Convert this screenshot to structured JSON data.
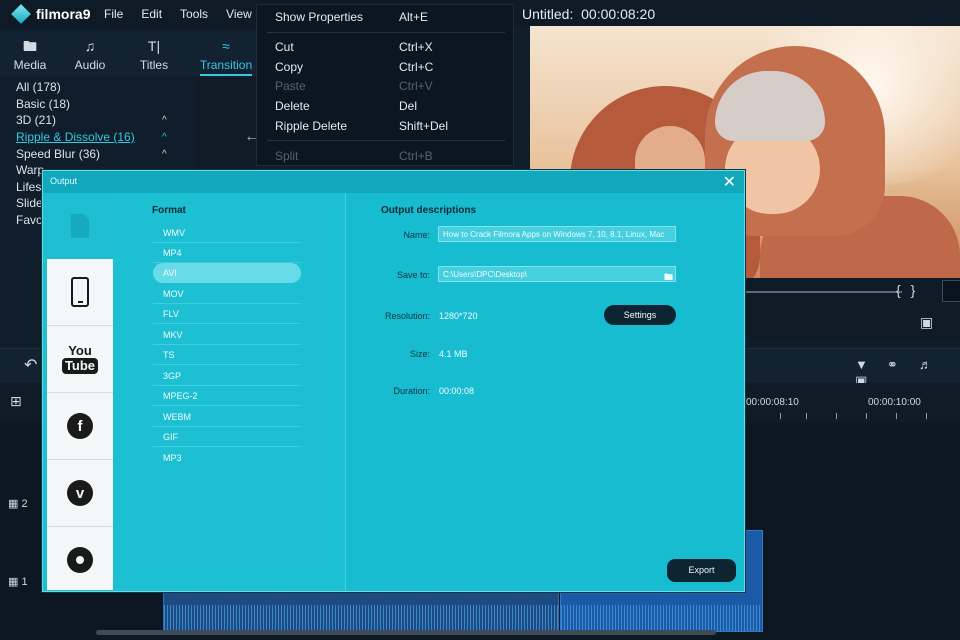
{
  "app": {
    "logo": "filmora",
    "logo_version": "9",
    "window_title": "Untitled:",
    "window_time": "00:00:08:20"
  },
  "menubar": {
    "items": [
      "File",
      "Edit",
      "Tools",
      "View"
    ]
  },
  "edit_menu": {
    "items": [
      {
        "label": "Show Properties",
        "shortcut": "Alt+E",
        "enabled": true
      },
      {
        "label": "Cut",
        "shortcut": "Ctrl+X",
        "enabled": true
      },
      {
        "label": "Copy",
        "shortcut": "Ctrl+C",
        "enabled": true
      },
      {
        "label": "Paste",
        "shortcut": "Ctrl+V",
        "enabled": false
      },
      {
        "label": "Delete",
        "shortcut": "Del",
        "enabled": true
      },
      {
        "label": "Ripple Delete",
        "shortcut": "Shift+Del",
        "enabled": true
      },
      {
        "label": "Split",
        "shortcut": "Ctrl+B",
        "enabled": false
      }
    ]
  },
  "tabs": [
    {
      "label": "Media",
      "icon": "folder-icon"
    },
    {
      "label": "Audio",
      "icon": "music-note-icon"
    },
    {
      "label": "Titles",
      "icon": "title-icon"
    },
    {
      "label": "Transition",
      "icon": "transition-icon",
      "active": true
    }
  ],
  "categories": [
    {
      "label": "All (178)"
    },
    {
      "label": "Basic (18)"
    },
    {
      "label": "3D (21)",
      "caret": true
    },
    {
      "label": "Ripple & Dissolve (16)",
      "caret": true,
      "active": true
    },
    {
      "label": "Speed Blur (36)",
      "caret": true
    },
    {
      "label": "Warp"
    },
    {
      "label": "Lifest"
    },
    {
      "label": "Slide"
    },
    {
      "label": "Favo"
    }
  ],
  "timeline": {
    "ruler": [
      "00:00:08:10",
      "00:00:10:00"
    ],
    "tracks": [
      {
        "label": "2"
      },
      {
        "label": "1"
      }
    ]
  },
  "output_dialog": {
    "title": "Output",
    "format_heading": "Format",
    "formats": [
      "WMV",
      "MP4",
      "AVI",
      "MOV",
      "FLV",
      "MKV",
      "TS",
      "3GP",
      "MPEG-2",
      "WEBM",
      "GIF",
      "MP3"
    ],
    "selected_format": "AVI",
    "sidebar": [
      "file-icon",
      "phone-icon",
      "youtube-icon",
      "facebook-icon",
      "vimeo-icon",
      "dvd-icon"
    ],
    "desc_heading": "Output descriptions",
    "name_label": "Name:",
    "name_value": "How to Crack Filmora Apps on Windows 7, 10, 8.1, Linux, Mac",
    "save_label": "Save to:",
    "save_value": "C:\\Users\\DPC\\Desktop\\",
    "resolution_label": "Resolution:",
    "resolution_value": "1280*720",
    "settings_label": "Settings",
    "size_label": "Size:",
    "size_value": "4.1 MB",
    "duration_label": "Duration:",
    "duration_value": "00:00:08",
    "export_label": "Export"
  },
  "colors": {
    "accent": "#34c9e0",
    "dialog_bg": "#1dbfd2",
    "dark_bg": "#101d2a"
  }
}
